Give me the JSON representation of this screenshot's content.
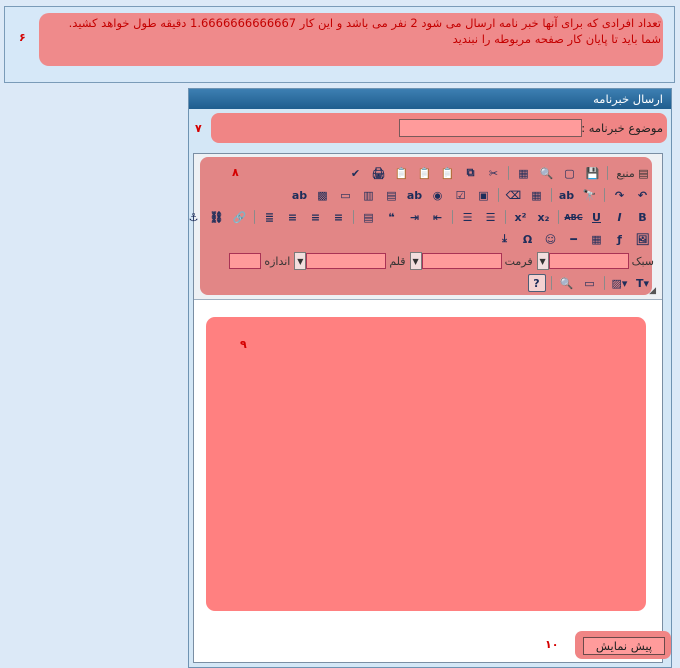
{
  "notice": {
    "text_line1": "تعداد افرادی که برای آنها خبر نامه ارسال می شود 2 نفر می باشد و این کار 1.6666666666667 دقیقه طول خواهد کشید.",
    "text_line2": "شما باید تا پایان کار صفحه مربوطه را نبندید",
    "marker": "۶"
  },
  "panel": {
    "title": "ارسال خبرنامه",
    "subject_label": "موضوع خبرنامه :",
    "subject_value": "",
    "subject_marker": "۷",
    "toolbar_marker": "۸",
    "body_marker": "۹",
    "preview_marker": "۱۰",
    "preview_label": "پیش نمایش"
  },
  "toolbar": {
    "source_label": "منبع",
    "row3": [
      "B",
      "I",
      "U",
      "ABC",
      "x₂",
      "x²"
    ],
    "style_label": "سبک",
    "format_label": "فرمت",
    "font_label": "قلم",
    "size_label": "اندازه"
  }
}
